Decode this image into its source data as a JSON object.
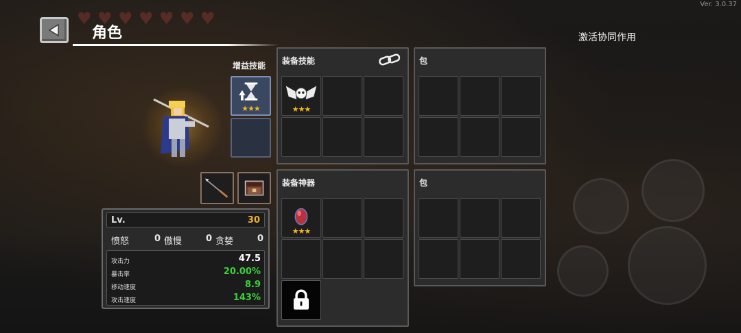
{
  "version": "Ver. 3.0.37",
  "header": {
    "title": "角色",
    "synergy_label": "激活协同作用"
  },
  "boost": {
    "label": "增益技能",
    "slots": [
      {
        "icon": "hourglass-up-icon",
        "stars": "★★★"
      },
      {
        "icon": "empty-slot"
      }
    ]
  },
  "gear": {
    "weapon_icon": "spear-icon",
    "armor_icon": "chest-armor-icon"
  },
  "stats": {
    "lv_label": "Lv.",
    "lv_value": "30",
    "traits": [
      {
        "name": "愤怒",
        "value": "0"
      },
      {
        "name": "傲慢",
        "value": "0"
      },
      {
        "name": "贪婪",
        "value": "0"
      }
    ],
    "substats": [
      {
        "key": "攻击力",
        "value": "47.5",
        "color": "#ffffff"
      },
      {
        "key": "暴击率",
        "value": "20.00%",
        "color": "#3ad13a"
      },
      {
        "key": "移动速度",
        "value": "8.9",
        "color": "#3ad13a"
      },
      {
        "key": "攻击速度",
        "value": "143%",
        "color": "#3ad13a"
      }
    ]
  },
  "skills_panel": {
    "title": "装备技能",
    "link_icon": "link-icon",
    "first_item": {
      "icon": "winged-skull-icon",
      "stars": "★★★"
    }
  },
  "skills_bag": {
    "title": "包"
  },
  "artifacts_panel": {
    "title": "装备神器",
    "first_item": {
      "icon": "red-gem-icon",
      "stars": "★★★"
    },
    "lock_icon": "lock-icon"
  },
  "artifacts_bag": {
    "title": "包"
  },
  "colors": {
    "accent_gold": "#f2b02a",
    "stat_green": "#3ad13a",
    "panel_bg": "#2c2c2c"
  }
}
